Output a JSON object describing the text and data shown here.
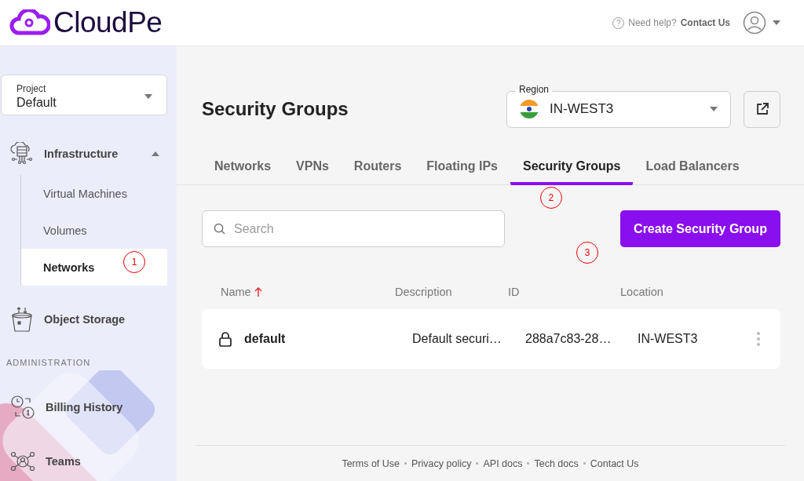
{
  "header": {
    "logo": "CloudPe",
    "help_icon": "?",
    "help_text": "Need help?",
    "help_link": "Contact Us"
  },
  "sidebar": {
    "project": {
      "label": "Project",
      "value": "Default"
    },
    "groups": [
      {
        "label": "Infrastructure",
        "expanded": true,
        "children": [
          {
            "label": "Virtual Machines",
            "selected": false
          },
          {
            "label": "Volumes",
            "selected": false
          },
          {
            "label": "Networks",
            "selected": true,
            "annotation": "1"
          }
        ]
      },
      {
        "label": "Object Storage"
      }
    ],
    "section_heading": "ADMINISTRATION",
    "admin_items": [
      {
        "label": "Billing History"
      },
      {
        "label": "Teams"
      }
    ]
  },
  "page": {
    "title": "Security Groups",
    "region": {
      "label": "Region",
      "value": "IN-WEST3"
    }
  },
  "tabs": [
    {
      "label": "Networks",
      "selected": false
    },
    {
      "label": "VPNs",
      "selected": false
    },
    {
      "label": "Routers",
      "selected": false
    },
    {
      "label": "Floating IPs",
      "selected": false
    },
    {
      "label": "Security Groups",
      "selected": true,
      "annotation": "2"
    },
    {
      "label": "Load Balancers",
      "selected": false
    }
  ],
  "search": {
    "placeholder": "Search"
  },
  "create_button": {
    "label": "Create Security Group",
    "annotation": "3"
  },
  "table": {
    "columns": [
      {
        "label": "Name",
        "sorted": true
      },
      {
        "label": "Description",
        "sorted": false
      },
      {
        "label": "ID",
        "sorted": false
      },
      {
        "label": "Location",
        "sorted": false
      }
    ],
    "rows": [
      {
        "name": "default",
        "description": "Default securi…",
        "id": "288a7c83-28…",
        "location": "IN-WEST3"
      }
    ]
  },
  "footer": {
    "links": [
      "Terms of Use",
      "Privacy policy",
      "API docs",
      "Tech docs",
      "Contact Us"
    ]
  }
}
